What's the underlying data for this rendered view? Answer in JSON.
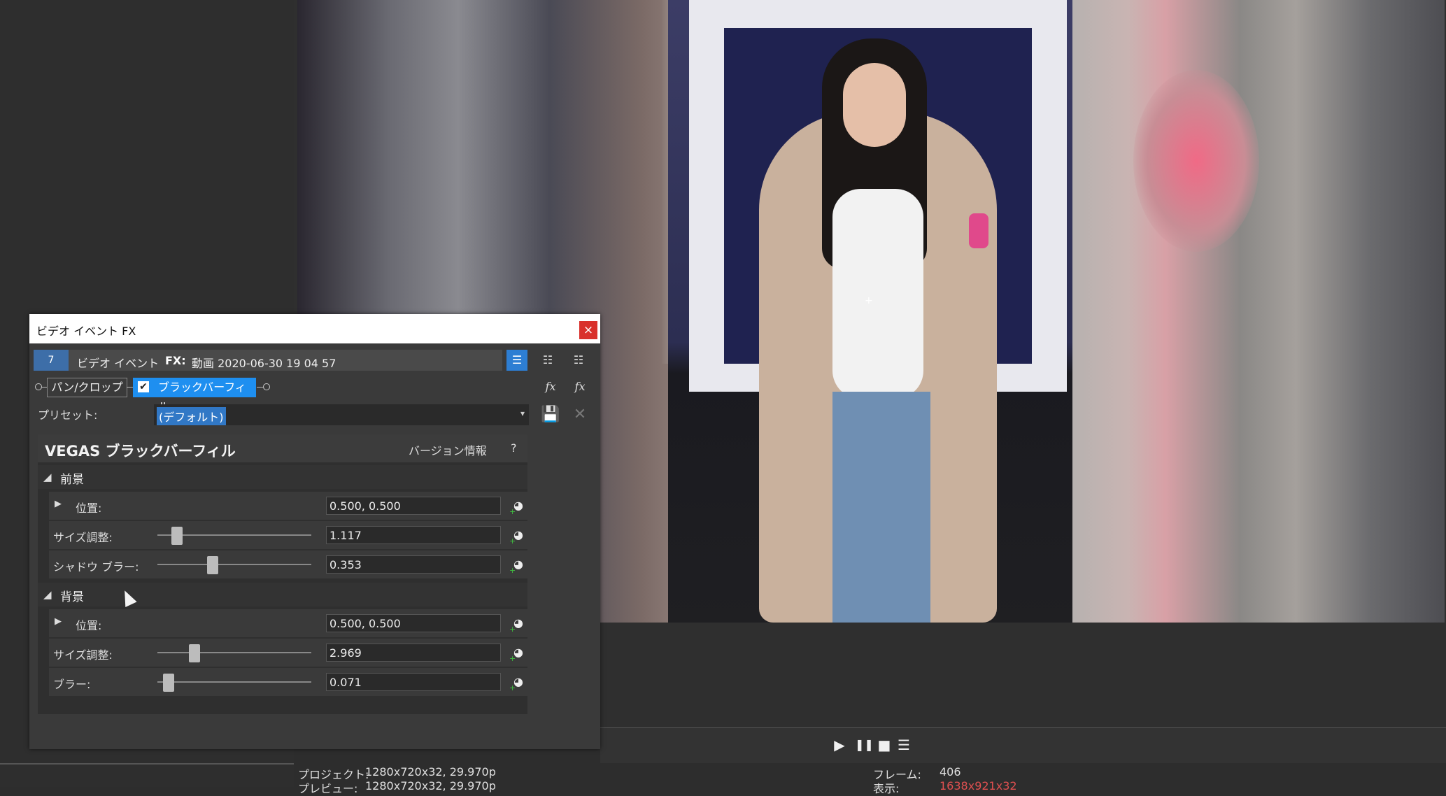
{
  "fx_window": {
    "title": "ビデオ イベント FX",
    "close_label": "×",
    "chain_header": {
      "icon_label": "7",
      "prefix": "ビデオ イベント",
      "fx_label": "FX:",
      "event_name": "動画 2020-06-30 19 04 57"
    },
    "view_buttons": [
      "☰",
      "☷",
      "☷"
    ],
    "plugins": [
      {
        "label": "パン/クロップ",
        "selected": false
      },
      {
        "label": "ブラックバーフィル",
        "selected": true,
        "checked": true
      }
    ],
    "side_buttons": {
      "add_fx": "fx",
      "remove_fx": "fx"
    },
    "preset": {
      "label": "プリセット:",
      "value": "(デフォルト)",
      "arrow": "▾",
      "save_icon": "💾",
      "delete_icon": "✕"
    },
    "plugin_panel": {
      "title": "VEGAS ブラックバーフィル",
      "version_info": "バージョン情報",
      "help": "?",
      "foreground": {
        "label": "前景",
        "arrow": "◢",
        "position": {
          "label": "位置:",
          "value": "0.500, 0.500",
          "expand": "▶"
        },
        "size": {
          "label": "サイズ調整:",
          "value": "1.117",
          "slider": 0.1
        },
        "shadow_blur": {
          "label": "シャドウ ブラー:",
          "value": "0.353",
          "slider": 0.35
        }
      },
      "background": {
        "label": "背景",
        "arrow": "◢",
        "position": {
          "label": "位置:",
          "value": "0.500, 0.500",
          "expand": "▶"
        },
        "size": {
          "label": "サイズ調整:",
          "value": "2.969",
          "slider": 0.22
        },
        "blur": {
          "label": "ブラー:",
          "value": "0.071",
          "slider": 0.04
        }
      },
      "keyframe_icon": "◕",
      "keyframe_plus": "+"
    }
  },
  "transport": {
    "play": "▶",
    "pause": "❚❚",
    "stop": "■",
    "menu": "☰"
  },
  "status": {
    "project_label": "プロジェクト:",
    "project_value": "1280x720x32, 29.970p",
    "preview_label": "プレビュー:",
    "preview_value": "1280x720x32, 29.970p",
    "frame_label": "フレーム:",
    "frame_value": "406",
    "display_label": "表示:",
    "display_value": "1638x921x32"
  },
  "colors": {
    "accent": "#1e8ff0",
    "close": "#d9312c",
    "status_red": "#e05050"
  }
}
